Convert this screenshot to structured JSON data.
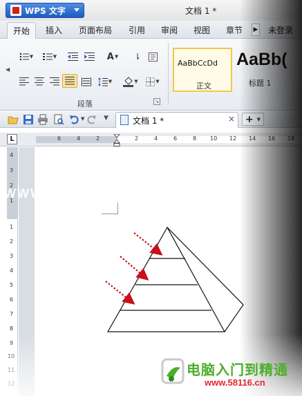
{
  "titlebar": {
    "app_button": "WPS 文字",
    "document_title": "文档 1 *"
  },
  "tabs": [
    {
      "label": "开始",
      "active": true
    },
    {
      "label": "插入"
    },
    {
      "label": "页面布局"
    },
    {
      "label": "引用"
    },
    {
      "label": "审阅"
    },
    {
      "label": "视图"
    },
    {
      "label": "章节"
    },
    {
      "label": "未登录"
    }
  ],
  "ribbon": {
    "paragraph_group_label": "段落",
    "styles": {
      "normal_sample": "AaBbCcDd",
      "normal_name": "正文",
      "heading1_sample": "AaBb(",
      "heading1_name": "标题 1"
    }
  },
  "doc_tabs": {
    "active_label": "文档 1 *",
    "close_glyph": "×",
    "new_tab_glyph": "+"
  },
  "ruler": {
    "corner_glyph": "L",
    "h_labels": [
      "6",
      "4",
      "2",
      "2",
      "4",
      "6",
      "8",
      "10",
      "12",
      "14",
      "16",
      "18"
    ],
    "v_labels": [
      "4",
      "3",
      "2",
      "1",
      "1",
      "1",
      "2",
      "3",
      "4",
      "5",
      "6",
      "7",
      "8",
      "9",
      "10",
      "11",
      "12"
    ]
  },
  "watermark": {
    "left_text": "WWW",
    "brand": "电脑入门到精通",
    "url": "www.58116.cn"
  },
  "colors": {
    "accent": "#1d5bbf",
    "arrow": "#c8101b",
    "brand_green": "#4cae2a",
    "url_red": "#e2252b"
  }
}
